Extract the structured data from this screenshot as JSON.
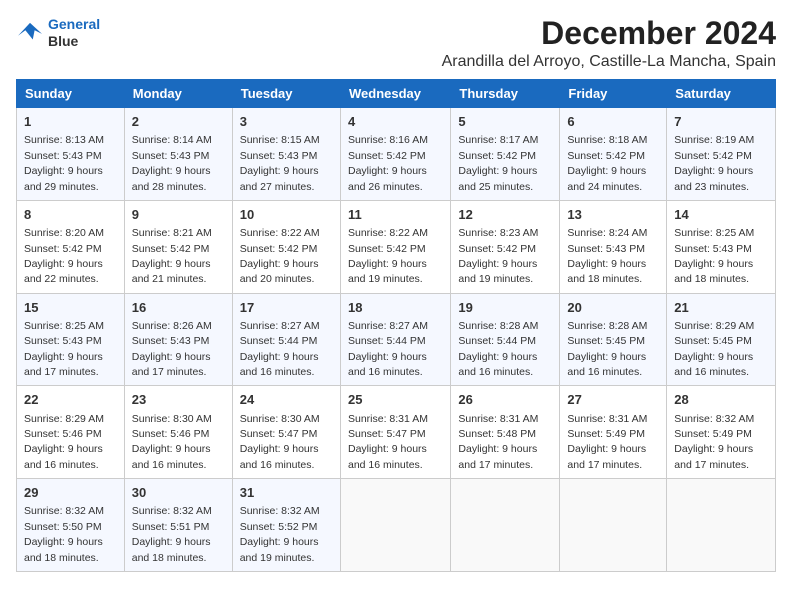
{
  "logo": {
    "line1": "General",
    "line2": "Blue"
  },
  "header": {
    "month": "December 2024",
    "location": "Arandilla del Arroyo, Castille-La Mancha, Spain"
  },
  "weekdays": [
    "Sunday",
    "Monday",
    "Tuesday",
    "Wednesday",
    "Thursday",
    "Friday",
    "Saturday"
  ],
  "weeks": [
    [
      {
        "day": "1",
        "sunrise": "8:13 AM",
        "sunset": "5:43 PM",
        "daylight": "9 hours and 29 minutes."
      },
      {
        "day": "2",
        "sunrise": "8:14 AM",
        "sunset": "5:43 PM",
        "daylight": "9 hours and 28 minutes."
      },
      {
        "day": "3",
        "sunrise": "8:15 AM",
        "sunset": "5:43 PM",
        "daylight": "9 hours and 27 minutes."
      },
      {
        "day": "4",
        "sunrise": "8:16 AM",
        "sunset": "5:42 PM",
        "daylight": "9 hours and 26 minutes."
      },
      {
        "day": "5",
        "sunrise": "8:17 AM",
        "sunset": "5:42 PM",
        "daylight": "9 hours and 25 minutes."
      },
      {
        "day": "6",
        "sunrise": "8:18 AM",
        "sunset": "5:42 PM",
        "daylight": "9 hours and 24 minutes."
      },
      {
        "day": "7",
        "sunrise": "8:19 AM",
        "sunset": "5:42 PM",
        "daylight": "9 hours and 23 minutes."
      }
    ],
    [
      {
        "day": "8",
        "sunrise": "8:20 AM",
        "sunset": "5:42 PM",
        "daylight": "9 hours and 22 minutes."
      },
      {
        "day": "9",
        "sunrise": "8:21 AM",
        "sunset": "5:42 PM",
        "daylight": "9 hours and 21 minutes."
      },
      {
        "day": "10",
        "sunrise": "8:22 AM",
        "sunset": "5:42 PM",
        "daylight": "9 hours and 20 minutes."
      },
      {
        "day": "11",
        "sunrise": "8:22 AM",
        "sunset": "5:42 PM",
        "daylight": "9 hours and 19 minutes."
      },
      {
        "day": "12",
        "sunrise": "8:23 AM",
        "sunset": "5:42 PM",
        "daylight": "9 hours and 19 minutes."
      },
      {
        "day": "13",
        "sunrise": "8:24 AM",
        "sunset": "5:43 PM",
        "daylight": "9 hours and 18 minutes."
      },
      {
        "day": "14",
        "sunrise": "8:25 AM",
        "sunset": "5:43 PM",
        "daylight": "9 hours and 18 minutes."
      }
    ],
    [
      {
        "day": "15",
        "sunrise": "8:25 AM",
        "sunset": "5:43 PM",
        "daylight": "9 hours and 17 minutes."
      },
      {
        "day": "16",
        "sunrise": "8:26 AM",
        "sunset": "5:43 PM",
        "daylight": "9 hours and 17 minutes."
      },
      {
        "day": "17",
        "sunrise": "8:27 AM",
        "sunset": "5:44 PM",
        "daylight": "9 hours and 16 minutes."
      },
      {
        "day": "18",
        "sunrise": "8:27 AM",
        "sunset": "5:44 PM",
        "daylight": "9 hours and 16 minutes."
      },
      {
        "day": "19",
        "sunrise": "8:28 AM",
        "sunset": "5:44 PM",
        "daylight": "9 hours and 16 minutes."
      },
      {
        "day": "20",
        "sunrise": "8:28 AM",
        "sunset": "5:45 PM",
        "daylight": "9 hours and 16 minutes."
      },
      {
        "day": "21",
        "sunrise": "8:29 AM",
        "sunset": "5:45 PM",
        "daylight": "9 hours and 16 minutes."
      }
    ],
    [
      {
        "day": "22",
        "sunrise": "8:29 AM",
        "sunset": "5:46 PM",
        "daylight": "9 hours and 16 minutes."
      },
      {
        "day": "23",
        "sunrise": "8:30 AM",
        "sunset": "5:46 PM",
        "daylight": "9 hours and 16 minutes."
      },
      {
        "day": "24",
        "sunrise": "8:30 AM",
        "sunset": "5:47 PM",
        "daylight": "9 hours and 16 minutes."
      },
      {
        "day": "25",
        "sunrise": "8:31 AM",
        "sunset": "5:47 PM",
        "daylight": "9 hours and 16 minutes."
      },
      {
        "day": "26",
        "sunrise": "8:31 AM",
        "sunset": "5:48 PM",
        "daylight": "9 hours and 17 minutes."
      },
      {
        "day": "27",
        "sunrise": "8:31 AM",
        "sunset": "5:49 PM",
        "daylight": "9 hours and 17 minutes."
      },
      {
        "day": "28",
        "sunrise": "8:32 AM",
        "sunset": "5:49 PM",
        "daylight": "9 hours and 17 minutes."
      }
    ],
    [
      {
        "day": "29",
        "sunrise": "8:32 AM",
        "sunset": "5:50 PM",
        "daylight": "9 hours and 18 minutes."
      },
      {
        "day": "30",
        "sunrise": "8:32 AM",
        "sunset": "5:51 PM",
        "daylight": "9 hours and 18 minutes."
      },
      {
        "day": "31",
        "sunrise": "8:32 AM",
        "sunset": "5:52 PM",
        "daylight": "9 hours and 19 minutes."
      },
      null,
      null,
      null,
      null
    ]
  ],
  "labels": {
    "sunrise": "Sunrise:",
    "sunset": "Sunset:",
    "daylight": "Daylight:"
  }
}
